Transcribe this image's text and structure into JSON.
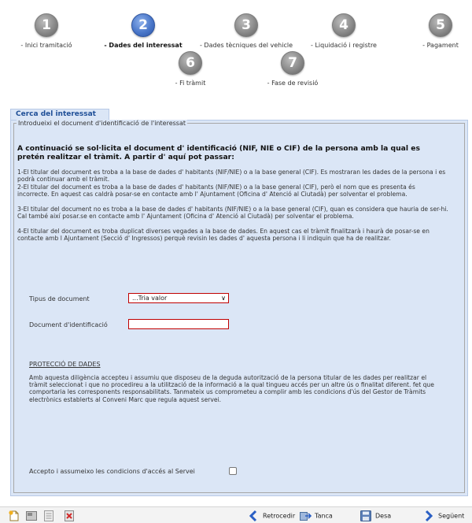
{
  "steps": [
    {
      "number": "1",
      "label": "- Inici tramitació"
    },
    {
      "number": "2",
      "label": "- Dades del interessat"
    },
    {
      "number": "3",
      "label": "- Dades tècniques del vehicle"
    },
    {
      "number": "4",
      "label": "- Liquidació i registre"
    },
    {
      "number": "5",
      "label": "- Pagament"
    },
    {
      "number": "6",
      "label": "- Fi tràmit"
    },
    {
      "number": "7",
      "label": "- Fase de revisió"
    }
  ],
  "active_step": 2,
  "panel": {
    "tab_label": "Cerca del interessat",
    "legend": "Introdueixi el document d'identificació de l'interessat",
    "heading": "A continuació se sol·licita el document d' identificació (NIF, NIE o CIF) de la persona amb la qual es pretén realitzar el tràmit. A partir d' aquí pot passar:",
    "paragraphs": [
      "1-El titular del document es troba a la base de dades d' habitants (NIF/NIE) o a la base general (CIF). Es mostraran les dades de la persona i es podrà continuar amb el tràmit.",
      "2-El titular del document es troba a la base de dades d' habitants (NIF/NIE) o a la base general (CIF), però el nom que es presenta és incorrecte. En aquest cas caldrà posar-se en contacte amb l' Ajuntament (Oficina d' Atenció al Ciutadà) per solventar el problema.",
      "3-El titular del document no es troba a la base de dades d' habitants (NIF/NIE) o a la base general (CIF), quan es considera que hauria de ser-hi. Cal també així posar.se en contacte amb l' Ajuntament (Oficina d' Atenció al Ciutadà) per solventar el problema.",
      "4-El titular del document es troba duplicat diverses vegades a la base de dades. En aquest cas el tràmit finalitzarà i haurà de posar-se en contacte amb l Ajuntament (Secció d' Ingressos) perquè revisin les dades d' aquesta persona i li indiquin que ha de realitzar."
    ]
  },
  "form": {
    "doc_type_label": "Tipus de document",
    "doc_type_value": "...Tria valor",
    "doc_id_label": "Document d'identificació",
    "doc_id_value": ""
  },
  "protection": {
    "title": "PROTECCIÓ DE DADES",
    "text": "Amb aquesta diligència accepteu i assumiu que disposeu de la deguda autorització de la persona titular de les dades per realitzar el tràmit seleccionat i que no procedireu a la utilització de la informació a la qual tingueu accés per un altre ús o finalitat diferent. fet que comportaria les corresponents responsabilitats. Tanmateix us comprometeu a complir amb les condicions d'ús del Gestor de Tràmits electrònics establerts al Conveni Marc que regula aquest servei."
  },
  "accept": {
    "label": "Accepto i assumeixo les condicions d'accés al Servei",
    "checked": false
  },
  "toolbar": {
    "back_label": "Retrocedir",
    "close_label": "Tanca",
    "save_label": "Desa",
    "next_label": "Següent"
  },
  "colors": {
    "active_step": "#3f6fc6",
    "inactive_step": "#8a8a8a",
    "panel_bg": "#dbe6f6",
    "tab_text": "#1f4f97",
    "required_border": "#c00000"
  }
}
